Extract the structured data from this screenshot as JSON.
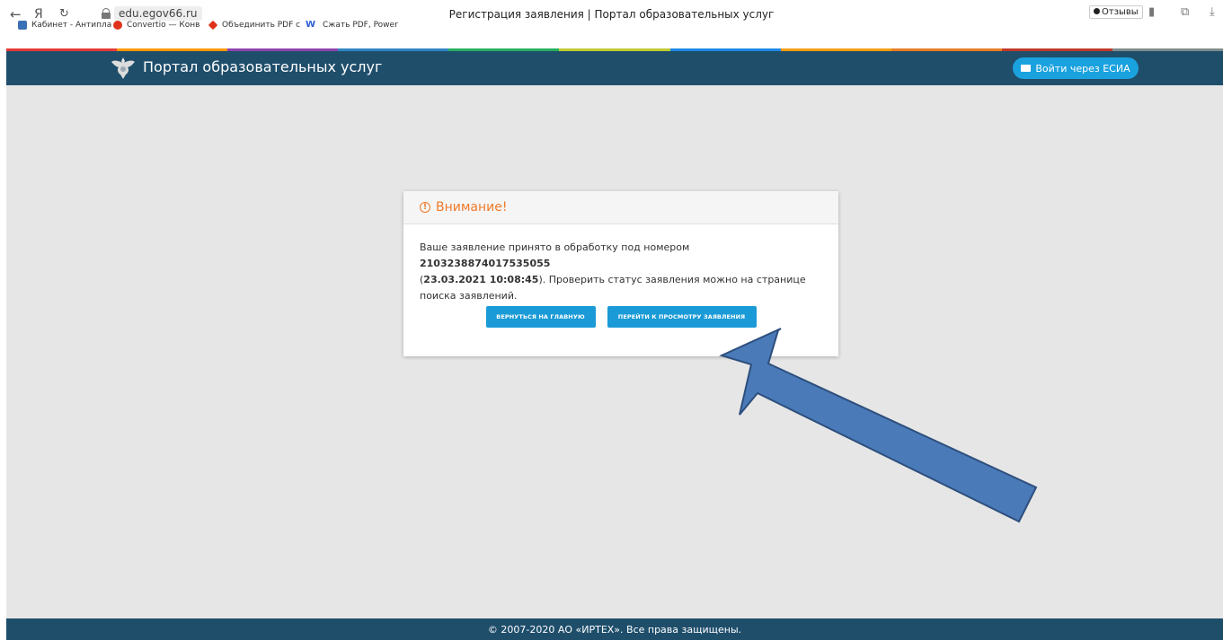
{
  "browser": {
    "back": "←",
    "yandex": "Я",
    "reload": "↻",
    "url": "edu.egov66.ru",
    "tab_title": "Регистрация заявления | Портал образовательных услуг",
    "feedback_label": "Отзывы",
    "bookmarks": [
      {
        "label": "Кабинет - Антипла",
        "color": "#3b6fb6"
      },
      {
        "label": "Convertio — Конв",
        "color": "#e0321b"
      },
      {
        "label": "Объединить PDF с",
        "color": "#e0321b"
      },
      {
        "label": "Сжать PDF, Power",
        "color": "#2a5bd7"
      }
    ]
  },
  "strip_colors": [
    "#e53935",
    "#ff9800",
    "#8e44ad",
    "#2e86c1",
    "#27ae60",
    "#c0ca33",
    "#1e88e5",
    "#f39c12",
    "#e67e22",
    "#c0392b",
    "#7f8c8d"
  ],
  "header": {
    "title": "Портал образовательных услуг",
    "esia_label": "Войти через ЕСИА"
  },
  "modal": {
    "title": "Внимание!",
    "text_1": "Ваше заявление принято в обработку под номером ",
    "number": "2103238874017535055",
    "text_2": "(",
    "datetime": "23.03.2021 10:08:45",
    "text_3": "). Проверить статус заявления можно на странице поиска заявлений.",
    "btn_home": "ВЕРНУТЬСЯ НА ГЛАВНУЮ",
    "btn_view": "ПЕРЕЙТИ К ПРОСМОТРУ ЗАЯВЛЕНИЯ"
  },
  "footer": {
    "text": "© 2007-2020 АО «ИРТЕХ». Все права защищены."
  },
  "colors": {
    "header_bg": "#1f4e6b",
    "accent": "#1a9ad6",
    "warning": "#f07a2a",
    "content_bg": "#e6e6e6",
    "annotation_arrow": "#4a7ab8"
  }
}
